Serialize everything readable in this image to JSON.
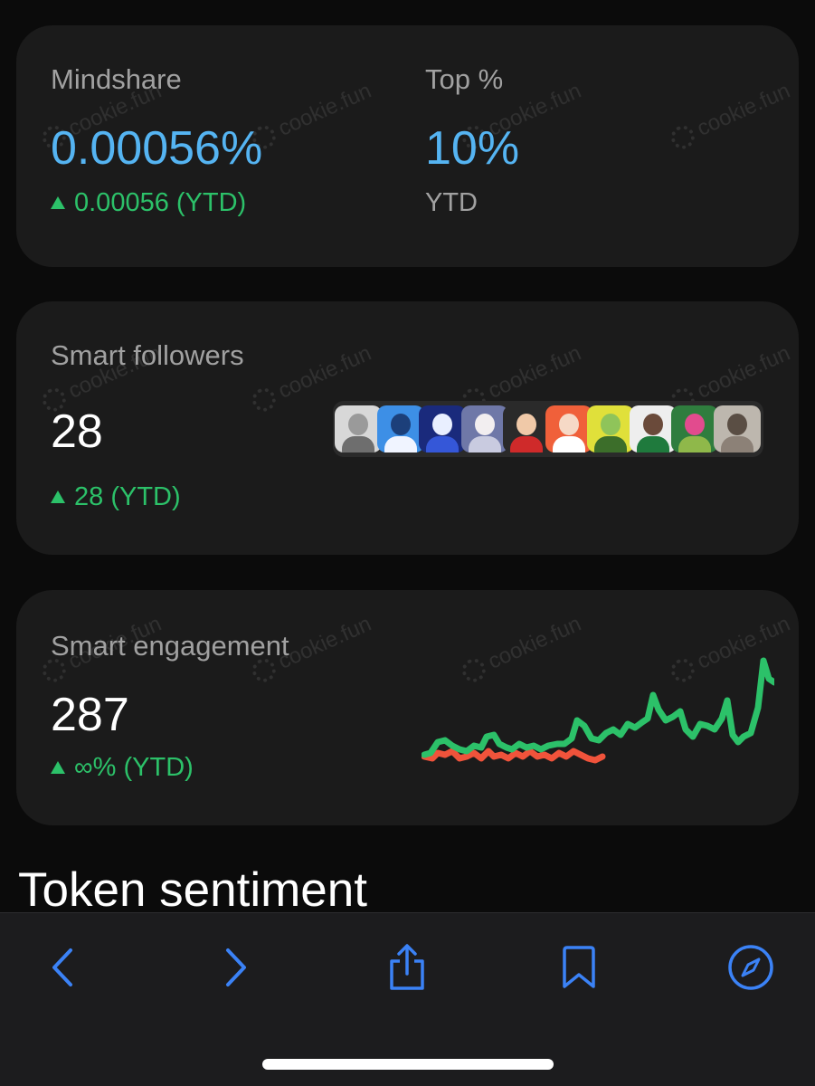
{
  "watermark": "cookie.fun",
  "mindshare": {
    "label": "Mindshare",
    "value": "0.00056%",
    "delta": "0.00056 (YTD)"
  },
  "top_percent": {
    "label": "Top %",
    "value": "10%",
    "period": "YTD"
  },
  "smart_followers": {
    "label": "Smart followers",
    "value": "28",
    "delta": "28 (YTD)",
    "avatars": [
      {
        "name": "avatar-statue",
        "bg": "#d8d8d8",
        "head": "#9a9a9a",
        "body": "#6e6e6e"
      },
      {
        "name": "avatar-penguin",
        "bg": "#3d8fe6",
        "head": "#1c3f7a",
        "body": "#f0f4ff"
      },
      {
        "name": "avatar-robot",
        "bg": "#1a2a7c",
        "head": "#e9efff",
        "body": "#3557d8"
      },
      {
        "name": "avatar-anime-white",
        "bg": "#6f78a8",
        "head": "#f2eef0",
        "body": "#c9cbe0"
      },
      {
        "name": "avatar-red-outfit",
        "bg": "#2a2a2a",
        "head": "#f0c9a8",
        "body": "#cf2a2a"
      },
      {
        "name": "avatar-orange-girl",
        "bg": "#f0603a",
        "head": "#f6d9c6",
        "body": "#ffffff"
      },
      {
        "name": "avatar-green-zombie",
        "bg": "#e0e03a",
        "head": "#8fc45a",
        "body": "#3c6e2a"
      },
      {
        "name": "avatar-green-cap",
        "bg": "#eeeeee",
        "head": "#6a4a3a",
        "body": "#1f7a3d"
      },
      {
        "name": "avatar-frog",
        "bg": "#2f7d3e",
        "head": "#e24b8e",
        "body": "#8fb84a"
      },
      {
        "name": "avatar-sketch",
        "bg": "#bdb7ae",
        "head": "#5a4e44",
        "body": "#8c8177"
      }
    ]
  },
  "smart_engagement": {
    "label": "Smart engagement",
    "value": "287",
    "delta": "∞% (YTD)"
  },
  "token_sentiment": {
    "title": "Token sentiment"
  },
  "colors": {
    "accent_blue": "#55b4f2",
    "positive_green": "#2cc169",
    "negative_red": "#f0533b",
    "toolbar_blue": "#3b82f6"
  },
  "toolbar": {
    "back": "chevron-left-icon",
    "forward": "chevron-right-icon",
    "share": "share-icon",
    "bookmarks": "bookmark-icon",
    "safari": "compass-icon"
  }
}
